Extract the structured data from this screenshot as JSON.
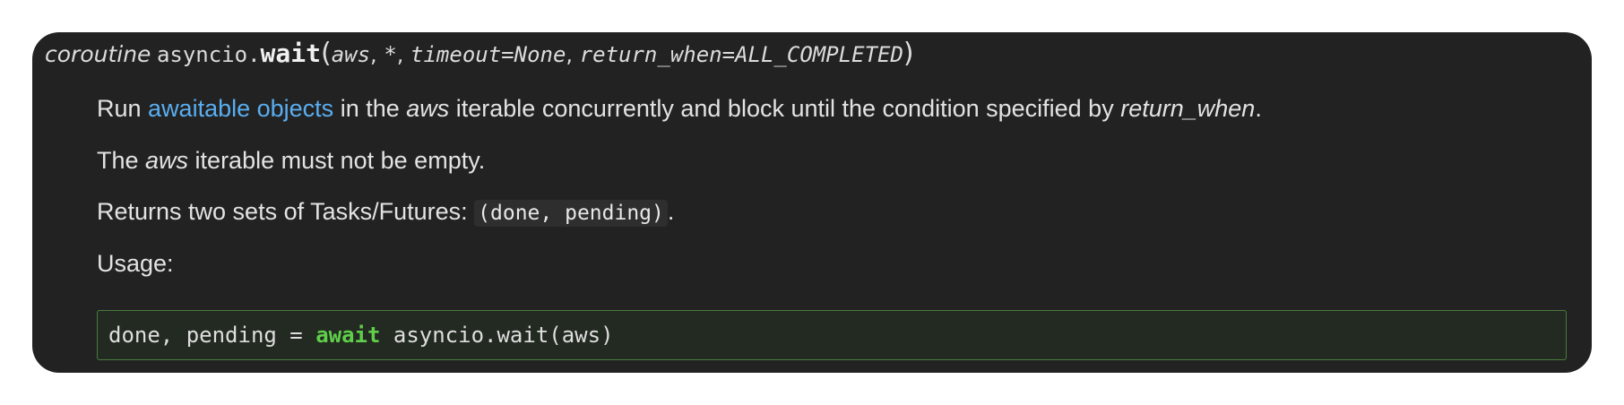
{
  "signature": {
    "prefix": "coroutine",
    "module": "asyncio.",
    "name": "wait",
    "open_paren": "(",
    "params": [
      {
        "text": "aws"
      },
      {
        "text": "*"
      },
      {
        "text": "timeout=None"
      },
      {
        "text": "return_when=ALL_COMPLETED"
      }
    ],
    "separator": ", ",
    "close_paren": ")"
  },
  "para1": {
    "before": "Run ",
    "link": "awaitable objects",
    "mid1": " in the ",
    "em1": "aws",
    "mid2": " iterable concurrently and block until the condition specified by ",
    "em2": "return_when",
    "end": "."
  },
  "para2": {
    "before": "The ",
    "em": "aws",
    "after": " iterable must not be empty."
  },
  "para3": {
    "before": "Returns two sets of Tasks/Futures: ",
    "code": "(done, pending)",
    "after": "."
  },
  "para4": {
    "text": "Usage:"
  },
  "code_block": {
    "before": "done, pending = ",
    "keyword": "await",
    "after": " asyncio.wait(aws)"
  },
  "colors": {
    "panel_bg": "#222222",
    "link": "#5aaef0",
    "keyword": "#5fcf4a",
    "code_border": "#4a7a3e"
  }
}
